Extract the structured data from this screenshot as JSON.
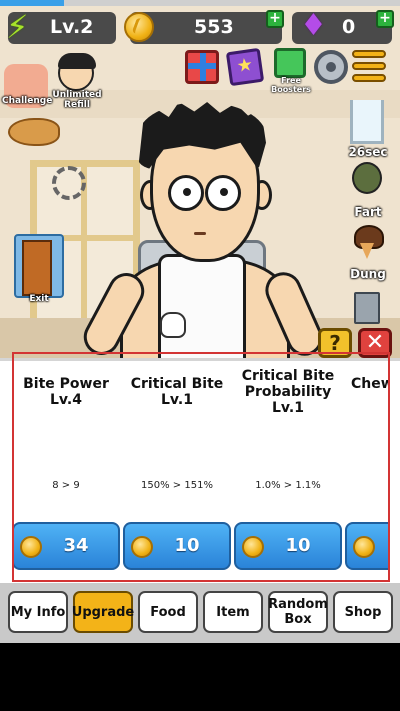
{
  "hud": {
    "level": "Lv.2",
    "gold": "553",
    "gems": "0",
    "progress_fraction": 0.16
  },
  "side_icons": {
    "challenge_label": "Challenge",
    "refill_label": "Unlimited Refill",
    "exit_label": "Exit",
    "boosters_label": "Free Boosters"
  },
  "right_items": {
    "timer": "26sec",
    "fart": "Fart",
    "dung": "Dung"
  },
  "upgrades": [
    {
      "name": "Bite Power",
      "level": "Lv.4",
      "stat": "8 > 9",
      "price": "34"
    },
    {
      "name": "Critical Bite",
      "level": "Lv.1",
      "stat": "150% > 151%",
      "price": "10"
    },
    {
      "name": "Critical Bite Probability",
      "level": "Lv.1",
      "stat": "1.0% > 1.1%",
      "price": "10"
    },
    {
      "name": "Chew",
      "level": "",
      "stat": "",
      "price": ""
    }
  ],
  "tabs": [
    {
      "label": "My Info"
    },
    {
      "label": "Upgrade"
    },
    {
      "label": "Food"
    },
    {
      "label": "Item"
    },
    {
      "label": "Random Box"
    },
    {
      "label": "Shop"
    }
  ],
  "colors": {
    "accent_tab": "#f3b318",
    "buy_button": "#2a83d8",
    "panel_frame": "#d33434"
  }
}
